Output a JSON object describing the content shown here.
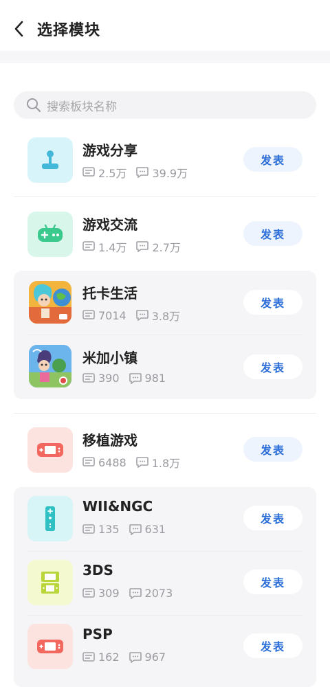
{
  "header": {
    "title": "选择模块",
    "back_icon": "chevron-left-icon"
  },
  "search": {
    "placeholder": "搜索板块名称",
    "icon": "search-icon"
  },
  "post_label": "发表",
  "items": [
    {
      "name": "游戏分享",
      "posts": "2.5万",
      "comments": "39.9万",
      "icon": "joystick-icon",
      "icon_bg": "#d8f4fb",
      "icon_color": "#43b8d8"
    },
    {
      "name": "游戏交流",
      "posts": "1.4万",
      "comments": "2.7万",
      "icon": "gamepad-icon",
      "icon_bg": "#d9f6ea",
      "icon_color": "#3cc98e"
    },
    {
      "name": "托卡生活",
      "posts": "7014",
      "comments": "3.8万",
      "icon": "toca-life-app-icon"
    },
    {
      "name": "米加小镇",
      "posts": "390",
      "comments": "981",
      "icon": "miga-town-app-icon"
    },
    {
      "name": "移植游戏",
      "posts": "6488",
      "comments": "1.8万",
      "icon": "handheld-console-icon",
      "icon_bg": "#fde3e0",
      "icon_color": "#f2675e"
    },
    {
      "name": "WII&NGC",
      "posts": "135",
      "comments": "631",
      "icon": "wii-remote-icon",
      "icon_bg": "#d7f5f6",
      "icon_color": "#2fc0c4"
    },
    {
      "name": "3DS",
      "posts": "309",
      "comments": "2073",
      "icon": "3ds-console-icon",
      "icon_bg": "#f4f9cf",
      "icon_color": "#b8d53a"
    },
    {
      "name": "PSP",
      "posts": "162",
      "comments": "967",
      "icon": "psp-console-icon",
      "icon_bg": "#fde3e0",
      "icon_color": "#f2675e"
    }
  ],
  "colors": {
    "accent": "#2d6fd8",
    "button_bg": "#eef4fd",
    "group_bg": "#f5f5f7",
    "muted_text": "#9a9aa0"
  }
}
